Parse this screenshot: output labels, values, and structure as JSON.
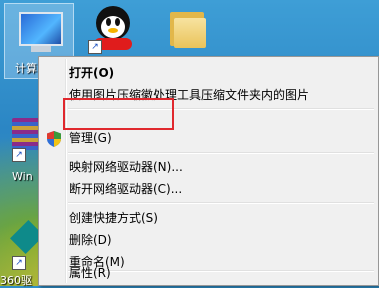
{
  "desktop": {
    "computer_label": "计算",
    "winrar_label": "Win",
    "app_360_label": "360驱"
  },
  "context_menu": {
    "items": [
      {
        "label": "打开(O)"
      },
      {
        "label": "使用图片压缩徽处理工具压缩文件夹内的图片"
      },
      {
        "label": "管理(G)"
      },
      {
        "label": "映射网络驱动器(N)..."
      },
      {
        "label": "断开网络驱动器(C)..."
      },
      {
        "label": "创建快捷方式(S)"
      },
      {
        "label": "删除(D)"
      },
      {
        "label": "重命名(M)"
      },
      {
        "label": "属性(R)"
      }
    ]
  },
  "annotation": {
    "color": "#e0282e"
  }
}
